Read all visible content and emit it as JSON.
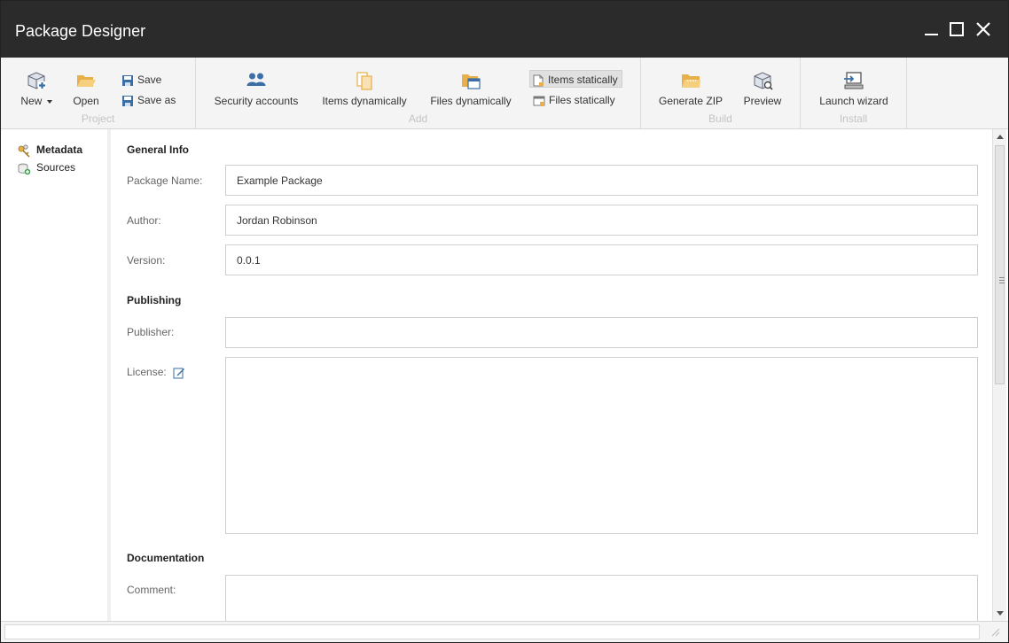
{
  "window": {
    "title": "Package Designer"
  },
  "ribbon": {
    "project": {
      "label": "Project",
      "new_label": "New",
      "open_label": "Open",
      "save_label": "Save",
      "save_as_label": "Save as"
    },
    "add": {
      "label": "Add",
      "security_accounts_label": "Security accounts",
      "items_dynamically_label": "Items dynamically",
      "files_dynamically_label": "Files dynamically",
      "items_statically_label": "Items statically",
      "files_statically_label": "Files statically"
    },
    "build": {
      "label": "Build",
      "generate_zip_label": "Generate ZIP",
      "preview_label": "Preview"
    },
    "install": {
      "label": "Install",
      "launch_wizard_label": "Launch wizard"
    }
  },
  "sidebar": {
    "items": [
      {
        "label": "Metadata",
        "active": true
      },
      {
        "label": "Sources",
        "active": false
      }
    ]
  },
  "form": {
    "general_info_heading": "General Info",
    "package_name_label": "Package Name:",
    "package_name_value": "Example Package",
    "author_label": "Author:",
    "author_value": "Jordan Robinson",
    "version_label": "Version:",
    "version_value": "0.0.1",
    "publishing_heading": "Publishing",
    "publisher_label": "Publisher:",
    "publisher_value": "",
    "license_label": "License:",
    "license_value": "",
    "documentation_heading": "Documentation",
    "comment_label": "Comment:",
    "comment_value": ""
  },
  "colors": {
    "titlebar": "#2b2b2b",
    "ribbon": "#f4f4f4",
    "icon_accent": "#e8b04a",
    "icon_blue": "#3a6ea5"
  },
  "icons": {
    "new": "package-new-icon",
    "open": "folder-open-icon",
    "save": "floppy-disk-icon",
    "save_as": "floppy-disk-icon",
    "security_accounts": "users-icon",
    "items_dynamically": "items-icon",
    "files_dynamically": "folder-files-icon",
    "items_statically": "document-icon",
    "files_statically": "window-file-icon",
    "generate_zip": "zip-folder-icon",
    "preview": "package-preview-icon",
    "launch_wizard": "wizard-monitor-icon",
    "metadata": "keys-icon",
    "sources": "sources-icon",
    "license_edit": "edit-icon"
  }
}
